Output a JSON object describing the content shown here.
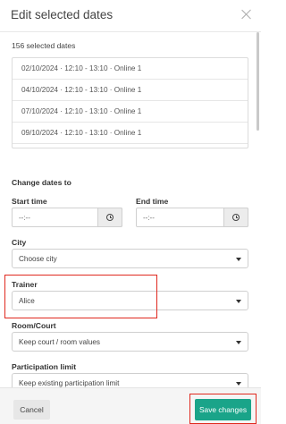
{
  "modal": {
    "title": "Edit selected dates",
    "selected_count": "156 selected dates"
  },
  "dates": [
    "02/10/2024 · 12:10 - 13:10 · Online 1",
    "04/10/2024 · 12:10 - 13:10 · Online 1",
    "07/10/2024 · 12:10 - 13:10 · Online 1",
    "09/10/2024 · 12:10 - 13:10 · Online 1"
  ],
  "form": {
    "section_title": "Change dates to",
    "start_time": {
      "label": "Start time",
      "value": "--:--"
    },
    "end_time": {
      "label": "End time",
      "value": "--:--"
    },
    "city": {
      "label": "City",
      "value": "Choose city"
    },
    "trainer": {
      "label": "Trainer",
      "value": "Alice"
    },
    "room": {
      "label": "Room/Court",
      "value": "Keep court / room values"
    },
    "participation": {
      "label": "Participation limit",
      "value": "Keep existing participation limit"
    }
  },
  "footer": {
    "cancel_label": "Cancel",
    "save_label": "Save changes"
  },
  "colors": {
    "accent": "#1aa489",
    "highlight": "#e0281e"
  },
  "icons": {
    "close": "close-icon",
    "clock": "clock-icon",
    "caret": "chevron-down-icon"
  }
}
